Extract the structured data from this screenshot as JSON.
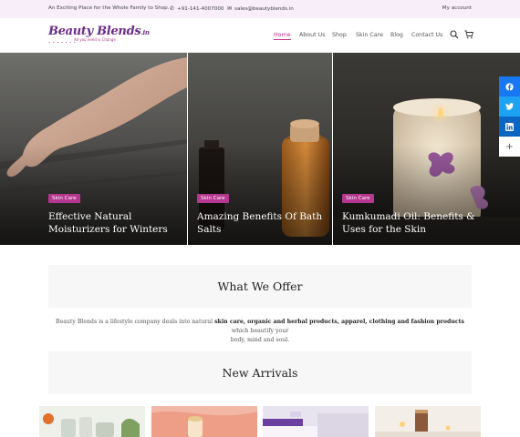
{
  "topbar": {
    "tagline": "An Exciting Place for the Whole Family to Shop.",
    "phone": "+91-141-4007000",
    "email": "sales@beautyblends.in",
    "account": "My account"
  },
  "logo": {
    "name": "Beauty Blends",
    "tld": ".in",
    "tagline": "All you need is Change"
  },
  "nav": [
    "Home",
    "About Us",
    "Shop",
    "Skin Care",
    "Blog",
    "Contact Us"
  ],
  "hero": [
    {
      "badge": "Skin Care",
      "title_line1": "Effective Natural",
      "title_line2": "Moisturizers for Winters"
    },
    {
      "badge": "Skin Care",
      "title_line1": "Amazing Benefits Of Bath",
      "title_line2": "Salts"
    },
    {
      "badge": "Skin Care",
      "title_line1": "Kumkumadi Oil: Benefits &",
      "title_line2": "Uses for the Skin"
    }
  ],
  "offer": {
    "heading": "What We Offer",
    "intro": "Beauty Blends is a lifestyle company deals into natural ",
    "bold1": "skin care, organic and herbal products, apparel, clothing and fashion products",
    "outro": " which beautify your",
    "line2": "body, mind and soul."
  },
  "arrivals": {
    "heading": "New Arrivals"
  },
  "colors": {
    "accent": "#c2338a",
    "topbar_bg": "#f7eefa",
    "logo": "#6a2a8a"
  }
}
